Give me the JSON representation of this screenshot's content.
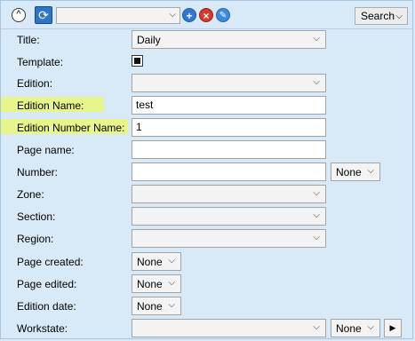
{
  "toolbar": {
    "collapse_glyph": "^",
    "refresh_glyph": "⟳",
    "combo_value": "",
    "add_glyph": "+",
    "delete_glyph": "×",
    "edit_glyph": "✎",
    "search_label": "Search"
  },
  "highlight_color": "#e7f58a",
  "form": {
    "title": {
      "label": "Title:",
      "value": "Daily"
    },
    "template": {
      "label": "Template:",
      "checked": true
    },
    "edition": {
      "label": "Edition:",
      "value": ""
    },
    "edition_name": {
      "label": "Edition Name:",
      "value": "test"
    },
    "edition_number_name": {
      "label": "Edition Number Name:",
      "value": "1"
    },
    "page_name": {
      "label": "Page name:",
      "value": ""
    },
    "number": {
      "label": "Number:",
      "value": "",
      "mode": "None"
    },
    "zone": {
      "label": "Zone:",
      "value": ""
    },
    "section": {
      "label": "Section:",
      "value": ""
    },
    "region": {
      "label": "Region:",
      "value": ""
    },
    "page_created": {
      "label": "Page created:",
      "value": "None"
    },
    "page_edited": {
      "label": "Page edited:",
      "value": "None"
    },
    "edition_date": {
      "label": "Edition date:",
      "value": "None"
    },
    "workstate": {
      "label": "Workstate:",
      "value": "",
      "mode": "None",
      "go_glyph": "▶"
    }
  }
}
